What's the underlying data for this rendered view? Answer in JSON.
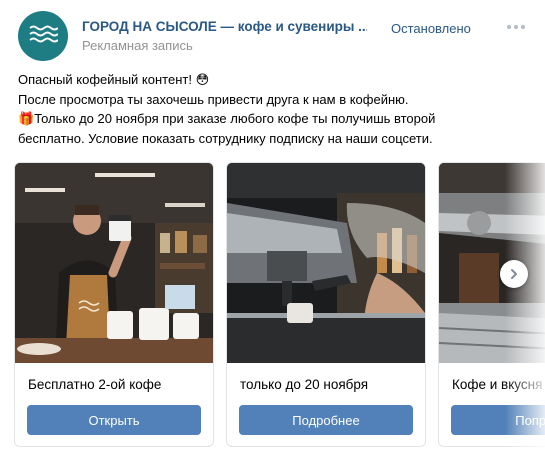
{
  "post": {
    "author": "ГОРОД НА СЫСОЛЕ — кофе и сувениры ...",
    "subtitle": "Рекламная запись",
    "status": "Остановлено",
    "avatar_icon": "waves-logo-icon",
    "more_icon": "more-dots-icon",
    "lines": [
      "Опасный кофейный контент!",
      "После просмотра ты захочешь привести друга к нам в кофейню.",
      "Только до 20 ноября при заказе любого кофе ты получишь второй",
      "бесплатно. Условие показать сотруднику подписку на наши соцсети."
    ],
    "line1_emoji": "😳",
    "line3_emoji": "🎁"
  },
  "carousel": {
    "cards": [
      {
        "caption": "Бесплатно 2-ой кофе",
        "button": "Открыть",
        "photo": "barista-with-cup-photo"
      },
      {
        "caption": "только до 20 ноября",
        "button": "Подробнее",
        "photo": "espresso-machine-photo"
      },
      {
        "caption": "Кофе и вкусня",
        "button": "Попроб",
        "photo": "coffee-machine-closeup-photo"
      }
    ],
    "next_icon": "chevron-right-icon"
  },
  "colors": {
    "link": "#2a5885",
    "button": "#5181b8",
    "avatar": "#1e7d83",
    "muted": "#939393"
  }
}
